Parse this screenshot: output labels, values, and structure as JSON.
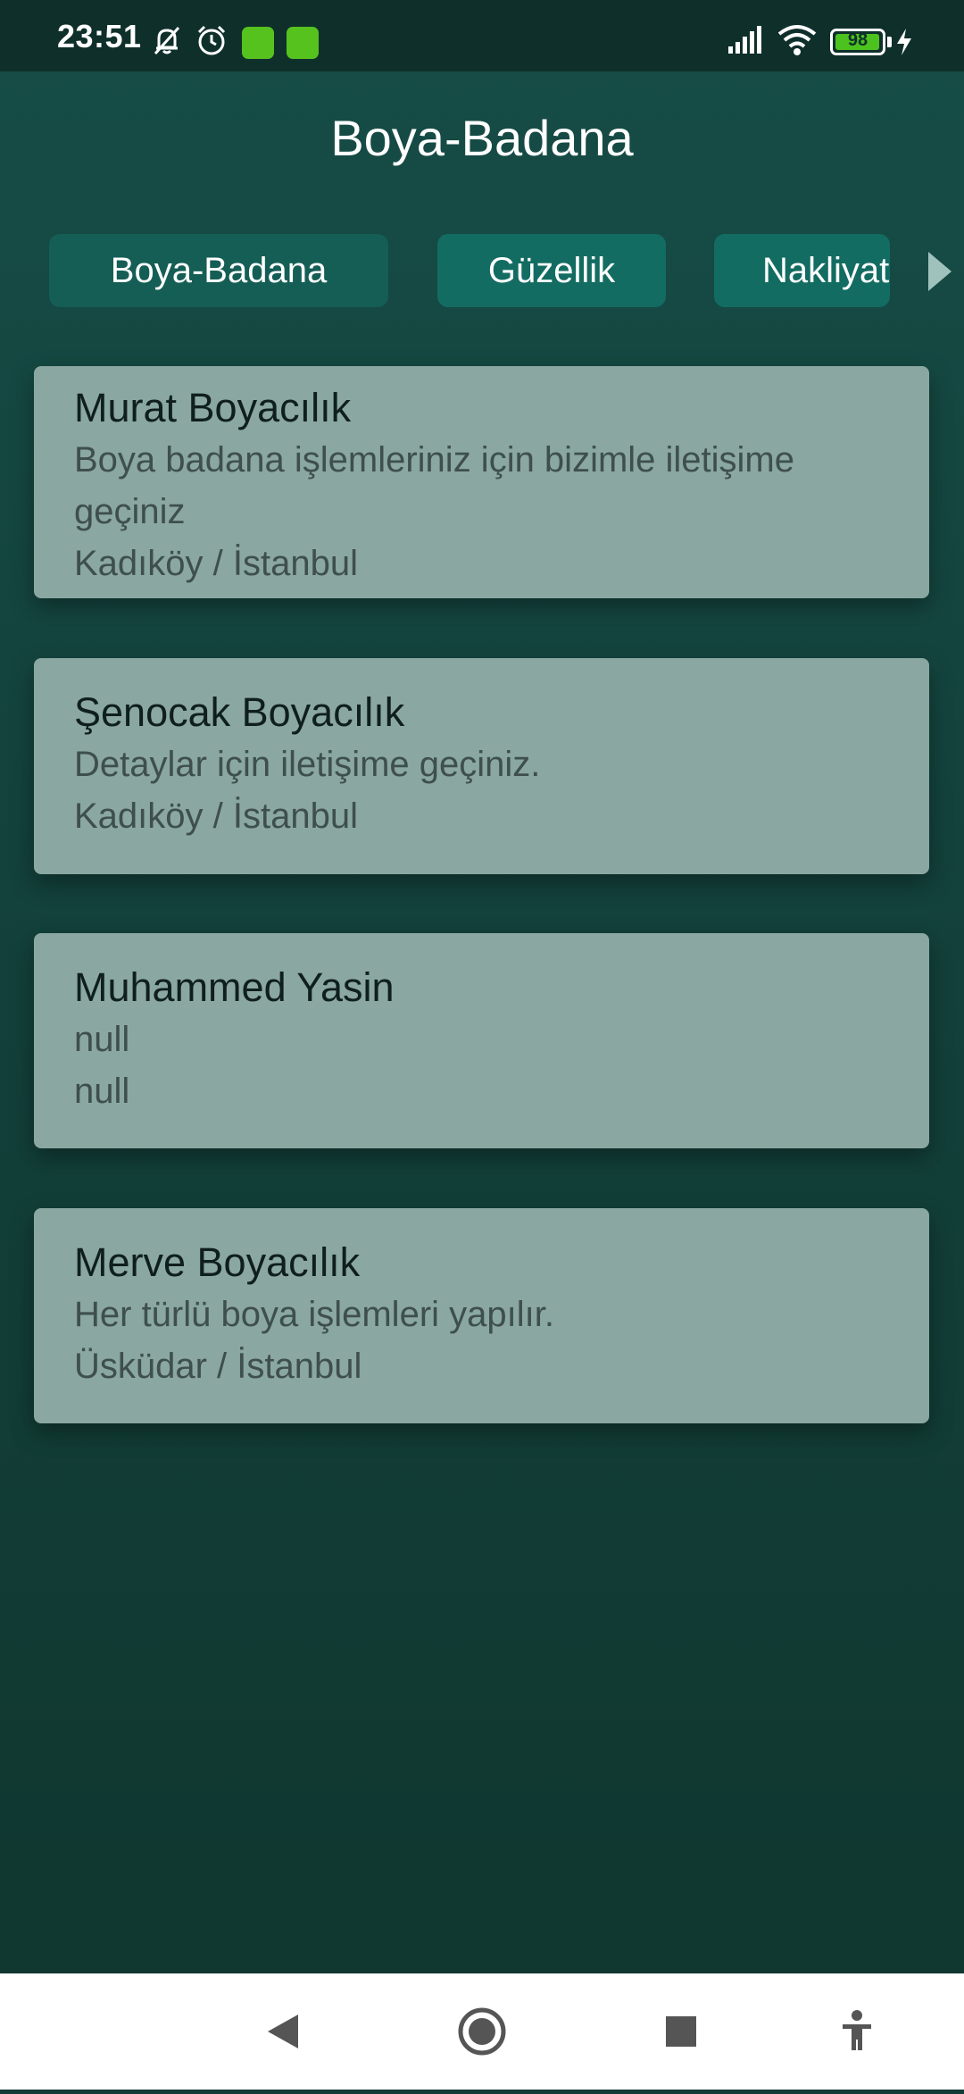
{
  "status_bar": {
    "time": "23:51",
    "battery_level": "98",
    "battery_fraction": 0.98,
    "icons": [
      "bell-muted-icon",
      "alarm-clock-icon",
      "app-notification-icon",
      "app-notification-icon",
      "signal-icon",
      "wifi-icon",
      "battery-icon",
      "charging-icon"
    ]
  },
  "header": {
    "title": "Boya-Badana"
  },
  "tabs": [
    {
      "label": "Boya-Badana",
      "active": true
    },
    {
      "label": "Güzellik",
      "active": false
    },
    {
      "label": "Nakliyat",
      "active": false
    }
  ],
  "listings": [
    {
      "name": "Murat Boyacılık",
      "description": "Boya badana işlemleriniz için bizimle iletişime geçiniz",
      "location": "Kadıköy / İstanbul"
    },
    {
      "name": "Şenocak Boyacılık",
      "description": "Detaylar için iletişime geçiniz.",
      "location": "Kadıköy / İstanbul"
    },
    {
      "name": "Muhammed Yasin",
      "description": "null",
      "location": "null"
    },
    {
      "name": "Merve Boyacılık",
      "description": "Her türlü boya işlemleri yapılır.",
      "location": "Üsküdar / İstanbul"
    }
  ],
  "nav_bar": {
    "icons": [
      "back-icon",
      "home-icon",
      "recents-icon",
      "accessibility-icon"
    ]
  },
  "colors": {
    "background": "#13413b",
    "status_bar": "#0f2f2b",
    "tab": "#136c62",
    "card": "#8aa7a1",
    "battery": "#4cc21f"
  }
}
